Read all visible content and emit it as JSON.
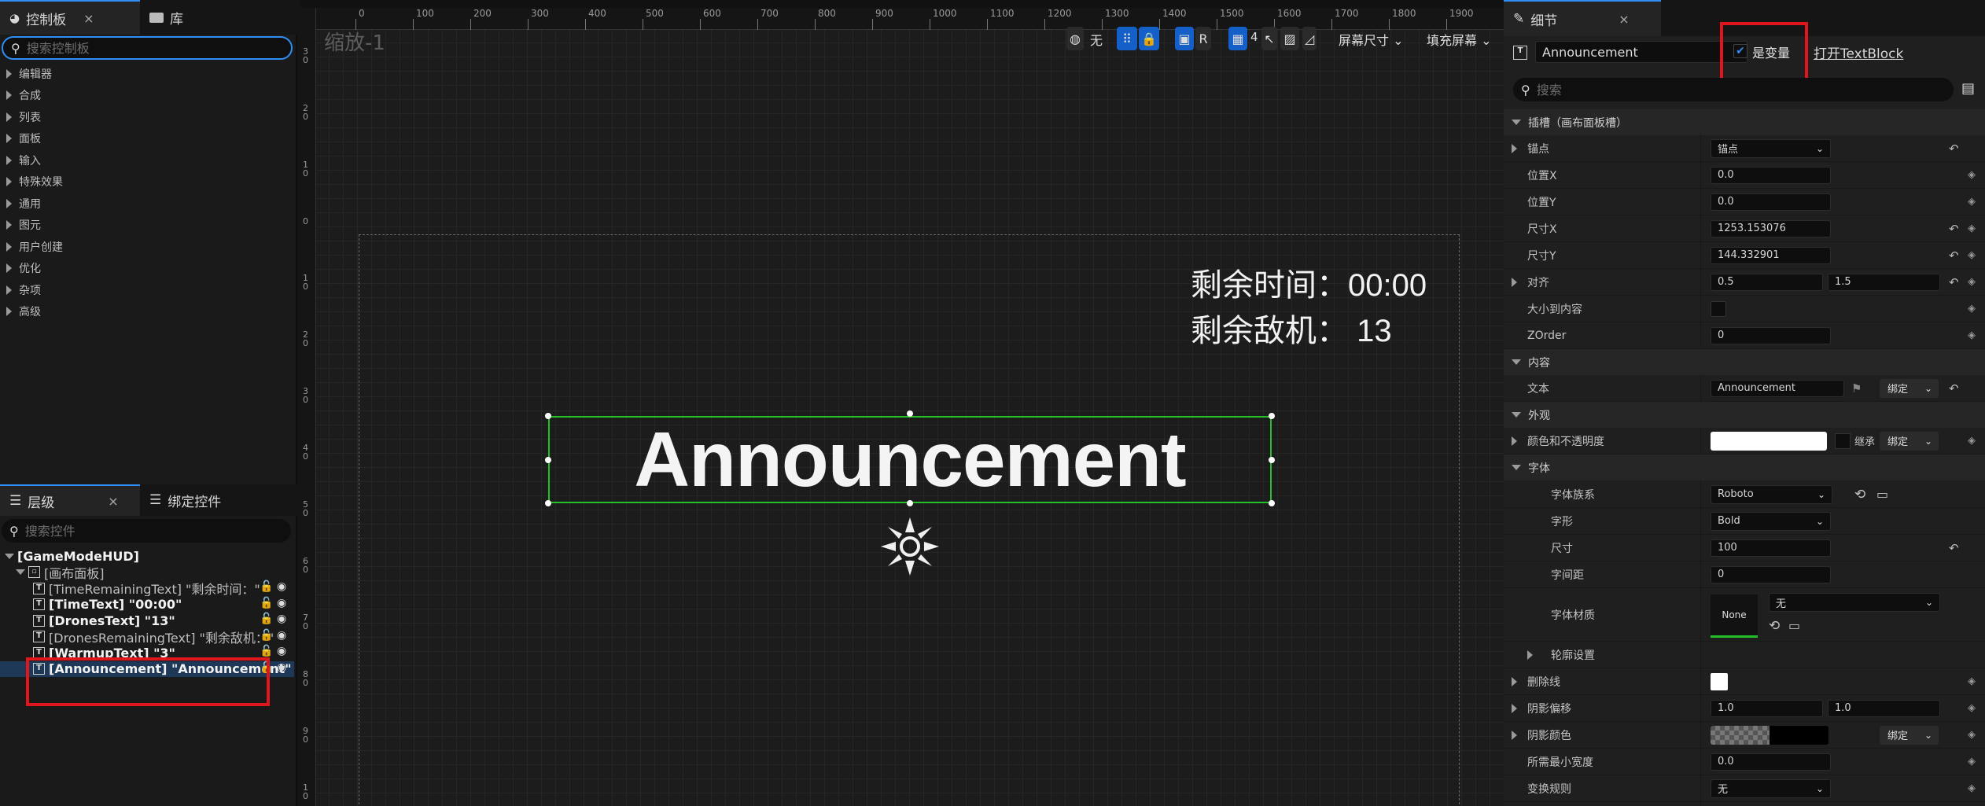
{
  "left": {
    "tabs": [
      {
        "label": "控制板",
        "close": "×"
      },
      {
        "label": "库"
      }
    ],
    "palette_search_placeholder": "搜索控制板",
    "categories": [
      "编辑器",
      "合成",
      "列表",
      "面板",
      "输入",
      "特殊效果",
      "通用",
      "图元",
      "用户创建",
      "优化",
      "杂项",
      "高级"
    ],
    "hierarchy_tabs": [
      {
        "label": "层级",
        "close": "×"
      },
      {
        "label": "绑定控件"
      }
    ],
    "hierarchy_search_placeholder": "搜索控件",
    "tree": [
      {
        "label": "[GameModeHUD]",
        "bold": true
      },
      {
        "label": "[画布面板]",
        "bold": false
      },
      {
        "label": "[TimeRemainingText] \"剩余时间：\"",
        "bold": false
      },
      {
        "label": "[TimeText] \"00:00\"",
        "bold": true
      },
      {
        "label": "[DronesText] \"13\"",
        "bold": true
      },
      {
        "label": "[DronesRemainingText] \"剩余敌机：\"",
        "bold": false
      },
      {
        "label": "[WarmupText] \"3\"",
        "bold": true
      },
      {
        "label": "[Announcement] \"Announcement\"",
        "bold": true
      }
    ]
  },
  "canvas": {
    "zoom_label": "缩放-1",
    "ruler_h": [
      "0",
      "100",
      "200",
      "300",
      "400",
      "500",
      "600",
      "700",
      "800",
      "900",
      "1000",
      "1100",
      "1200",
      "1300",
      "1400",
      "1500",
      "1600",
      "1700",
      "1800",
      "1900"
    ],
    "ruler_v": [
      "3 0",
      "2 0",
      "1 0",
      "0",
      "1 0",
      "2 0",
      "3 0",
      "4 0",
      "5 0",
      "6 0",
      "7 0",
      "8 0",
      "9 0",
      "1 0"
    ],
    "toolbar": {
      "none": "无",
      "r": "R",
      "grid": "4",
      "screen_size": "屏幕尺寸",
      "fill_screen": "填充屏幕"
    },
    "time_text": "剩余时间：00:00",
    "drones_text": "剩余敌机： 13",
    "announcement": "Announcement"
  },
  "details": {
    "tab_label": "细节",
    "tab_close": "×",
    "widget_name": "Announcement",
    "is_variable_label": "是变量",
    "open_link": "打开TextBlock",
    "search_placeholder": "搜索",
    "sections": {
      "slot": "插槽（画布面板槽）",
      "content": "内容",
      "appearance": "外观",
      "font": "字体"
    },
    "rows": {
      "anchor": {
        "label": "锚点",
        "value": "锚点"
      },
      "pos_x": {
        "label": "位置X",
        "value": "0.0"
      },
      "pos_y": {
        "label": "位置Y",
        "value": "0.0"
      },
      "size_x": {
        "label": "尺寸X",
        "value": "1253.153076"
      },
      "size_y": {
        "label": "尺寸Y",
        "value": "144.332901"
      },
      "align": {
        "label": "对齐",
        "value1": "0.5",
        "value2": "1.5"
      },
      "size_to_content": {
        "label": "大小到内容"
      },
      "zorder": {
        "label": "ZOrder",
        "value": "0"
      },
      "text": {
        "label": "文本",
        "value": "Announcement",
        "bind": "绑定"
      },
      "color": {
        "label": "颜色和不透明度",
        "inherit": "继承",
        "bind": "绑定"
      },
      "font_family": {
        "label": "字体族系",
        "value": "Roboto"
      },
      "typeface": {
        "label": "字形",
        "value": "Bold"
      },
      "size": {
        "label": "尺寸",
        "value": "100"
      },
      "letter_spacing": {
        "label": "字间距",
        "value": "0"
      },
      "font_material": {
        "label": "字体材质",
        "swatch": "None",
        "value": "无"
      },
      "outline": {
        "label": "轮廓设置"
      },
      "strike": {
        "label": "删除线"
      },
      "shadow_offset": {
        "label": "阴影偏移",
        "value1": "1.0",
        "value2": "1.0"
      },
      "shadow_color": {
        "label": "阴影颜色",
        "bind": "绑定"
      },
      "min_width": {
        "label": "所需最小宽度",
        "value": "0.0"
      },
      "transform": {
        "label": "变换规则",
        "value": "无"
      }
    }
  },
  "colors": {
    "accent": "#2f8ef5",
    "highlight_box": "#e0161c",
    "selection": "#23c02a"
  }
}
